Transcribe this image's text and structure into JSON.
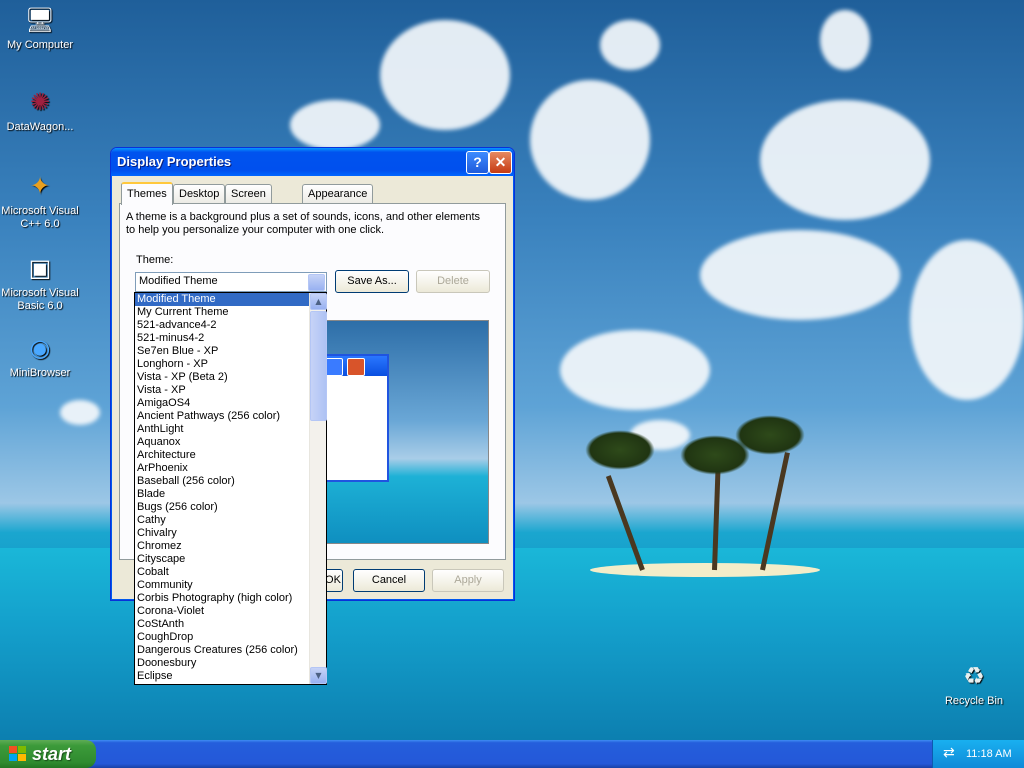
{
  "desktop": {
    "icons": [
      {
        "label": "My Computer",
        "icon": "computer-icon"
      },
      {
        "label": "DataWagon...",
        "icon": "datawagon-icon"
      },
      {
        "label": "Microsoft Visual C++ 6.0",
        "icon": "visual-cpp-icon"
      },
      {
        "label": "Microsoft Visual Basic 6.0",
        "icon": "visual-basic-icon"
      },
      {
        "label": "MiniBrowser",
        "icon": "minibrowser-icon"
      },
      {
        "label": "Recycle Bin",
        "icon": "recycle-bin-icon"
      }
    ]
  },
  "window": {
    "title": "Display Properties",
    "help_label": "?",
    "close_label": "✕",
    "tabs": [
      "Themes",
      "Desktop",
      "Screen Saver",
      "Appearance"
    ],
    "active_tab": "Themes",
    "description": "A theme is a background plus a set of sounds, icons, and other elements to help you personalize your computer with one click.",
    "theme_label": "Theme:",
    "theme_value": "Modified Theme",
    "save_as_label": "Save As...",
    "delete_label": "Delete",
    "ok_label": "OK",
    "cancel_label": "Cancel",
    "apply_label": "Apply"
  },
  "dropdown": {
    "selected": "Modified Theme",
    "items": [
      "Modified Theme",
      "My Current Theme",
      "521-advance4-2",
      "521-minus4-2",
      "Se7en Blue - XP",
      "Longhorn - XP",
      "Vista - XP (Beta 2)",
      "Vista - XP",
      "AmigaOS4",
      "Ancient Pathways (256 color)",
      "AnthLight",
      "Aquanox",
      "Architecture",
      "ArPhoenix",
      "Baseball (256 color)",
      "Blade",
      "Bugs (256 color)",
      "Cathy",
      "Chivalry",
      "Chromez",
      "Cityscape",
      "Cobalt",
      "Community",
      "Corbis Photography (high color)",
      "Corona-Violet",
      "CoStAnth",
      "CoughDrop",
      "Dangerous Creatures (256 color)",
      "Doonesbury",
      "Eclipse"
    ]
  },
  "taskbar": {
    "start_label": "start",
    "clock": "11:18 AM"
  },
  "colors": {
    "title_blue": "#0053ee",
    "selection": "#316ac5",
    "start_green": "#3c9a3a",
    "taskbar_blue": "#245edc"
  }
}
